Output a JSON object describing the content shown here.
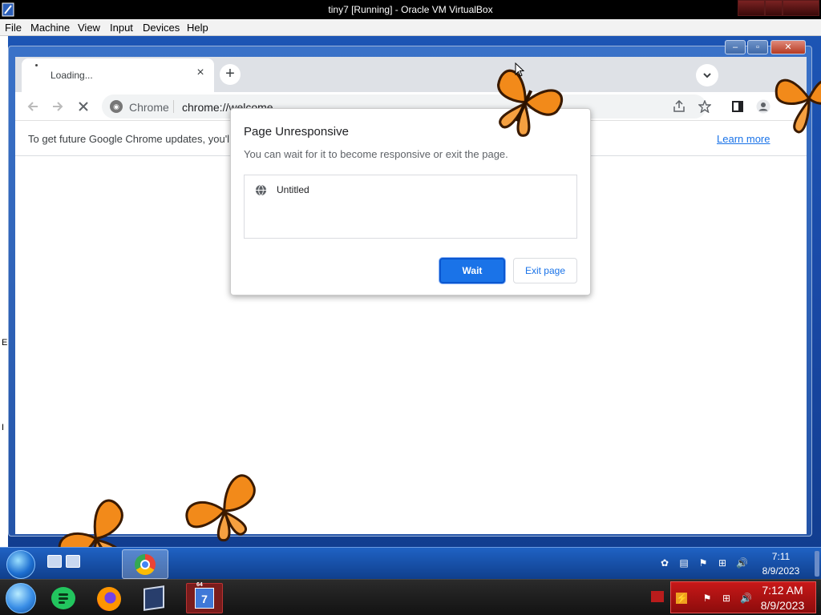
{
  "host_window": {
    "title": "tiny7 [Running] - Oracle VM VirtualBox",
    "menu": [
      "File",
      "Machine",
      "View",
      "Input",
      "Devices",
      "Help"
    ]
  },
  "browser": {
    "tab": {
      "title": "Loading...",
      "close": "×"
    },
    "new_tab": "+",
    "toolbar": {
      "site_label": "Chrome",
      "url": "chrome://welcome"
    },
    "infobar": {
      "text": "To get future Google Chrome updates, you'll",
      "link": "Learn more"
    }
  },
  "dialog": {
    "title": "Page Unresponsive",
    "subtitle": "You can wait for it to become responsive or exit the page.",
    "pages": [
      "Untitled"
    ],
    "wait_label": "Wait",
    "exit_label": "Exit page"
  },
  "guest_edge_letters": [
    "E",
    "I"
  ],
  "guest_taskbar": {
    "clock_time": "7:11",
    "clock_date": "8/9/2023"
  },
  "host_taskbar": {
    "tiny7_badge": "7",
    "tiny7_bits": "64",
    "clock_time": "7:12 AM",
    "clock_date": "8/9/2023"
  },
  "colors": {
    "accent": "#1a73e8",
    "guest_wallpaper": "#1c55b4",
    "host_tray": "#c81818",
    "butterfly_orange": "#f28a1a"
  },
  "icons": [
    "back-arrow-icon",
    "forward-arrow-icon",
    "stop-loading-icon",
    "share-icon",
    "star-icon",
    "side-panel-icon",
    "profile-icon",
    "globe-icon",
    "chevron-down-icon",
    "butterfly-icon"
  ]
}
